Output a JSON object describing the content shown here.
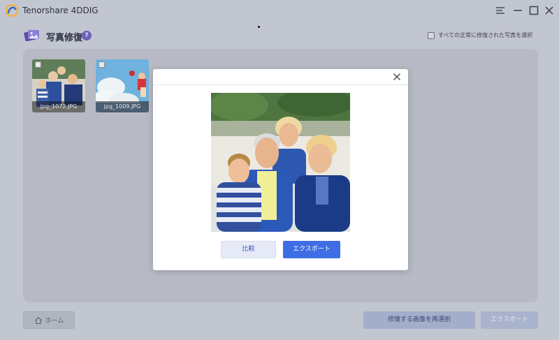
{
  "app": {
    "title": "Tenorshare 4DDIG",
    "accent": "#3f6de3"
  },
  "header": {
    "section_title": "写真修復",
    "help_label": "?",
    "select_all_label": "すべての正常に修復された写真を選択"
  },
  "gallery": {
    "items": [
      {
        "filename": "jpg_1072.JPG"
      },
      {
        "filename": "jpg_1009.JPG"
      }
    ]
  },
  "modal": {
    "compare_label": "比較",
    "export_label": "エクスポート"
  },
  "footer": {
    "home_label": "ホーム",
    "reselect_label": "修復する画像を再選択",
    "export_label": "エクスポート"
  }
}
